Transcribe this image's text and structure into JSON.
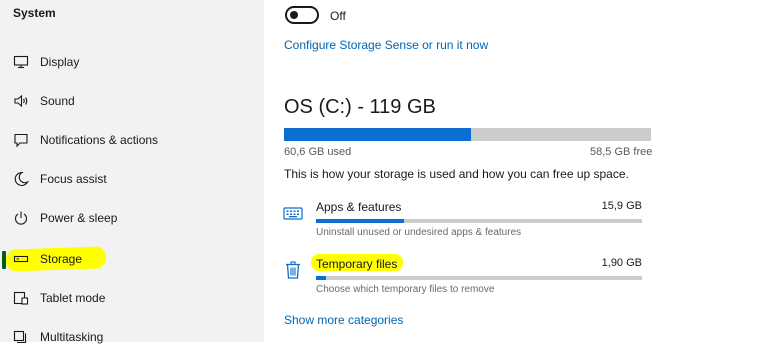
{
  "sidebar": {
    "title": "System",
    "items": [
      {
        "label": "Display",
        "icon": "monitor-icon"
      },
      {
        "label": "Sound",
        "icon": "speaker-icon"
      },
      {
        "label": "Notifications & actions",
        "icon": "notification-icon"
      },
      {
        "label": "Focus assist",
        "icon": "moon-icon"
      },
      {
        "label": "Power & sleep",
        "icon": "power-icon"
      },
      {
        "label": "Storage",
        "icon": "storage-icon",
        "selected": true
      },
      {
        "label": "Tablet mode",
        "icon": "tablet-icon"
      },
      {
        "label": "Multitasking",
        "icon": "multitasking-icon"
      }
    ]
  },
  "storage_sense": {
    "toggle_state": "Off",
    "configure_link": "Configure Storage Sense or run it now"
  },
  "drive": {
    "title": "OS (C:) - 119 GB",
    "used": "60,6 GB used",
    "free": "58,5 GB free",
    "used_fraction": 0.509,
    "description": "This is how your storage is used and how you can free up space."
  },
  "categories": [
    {
      "name": "Apps & features",
      "size": "15,9 GB",
      "description": "Uninstall unused or undesired apps & features",
      "fraction": 0.27,
      "icon": "keyboard-icon"
    },
    {
      "name": "Temporary files",
      "size": "1,90 GB",
      "description": "Choose which temporary files to remove",
      "fraction": 0.03,
      "icon": "trash-icon"
    }
  ],
  "show_more_link": "Show more categories",
  "colors": {
    "accent": "#0a6fd1",
    "link": "#0066b4",
    "highlight": "#ffff00",
    "sidebar_bg": "#f2f2f2"
  }
}
